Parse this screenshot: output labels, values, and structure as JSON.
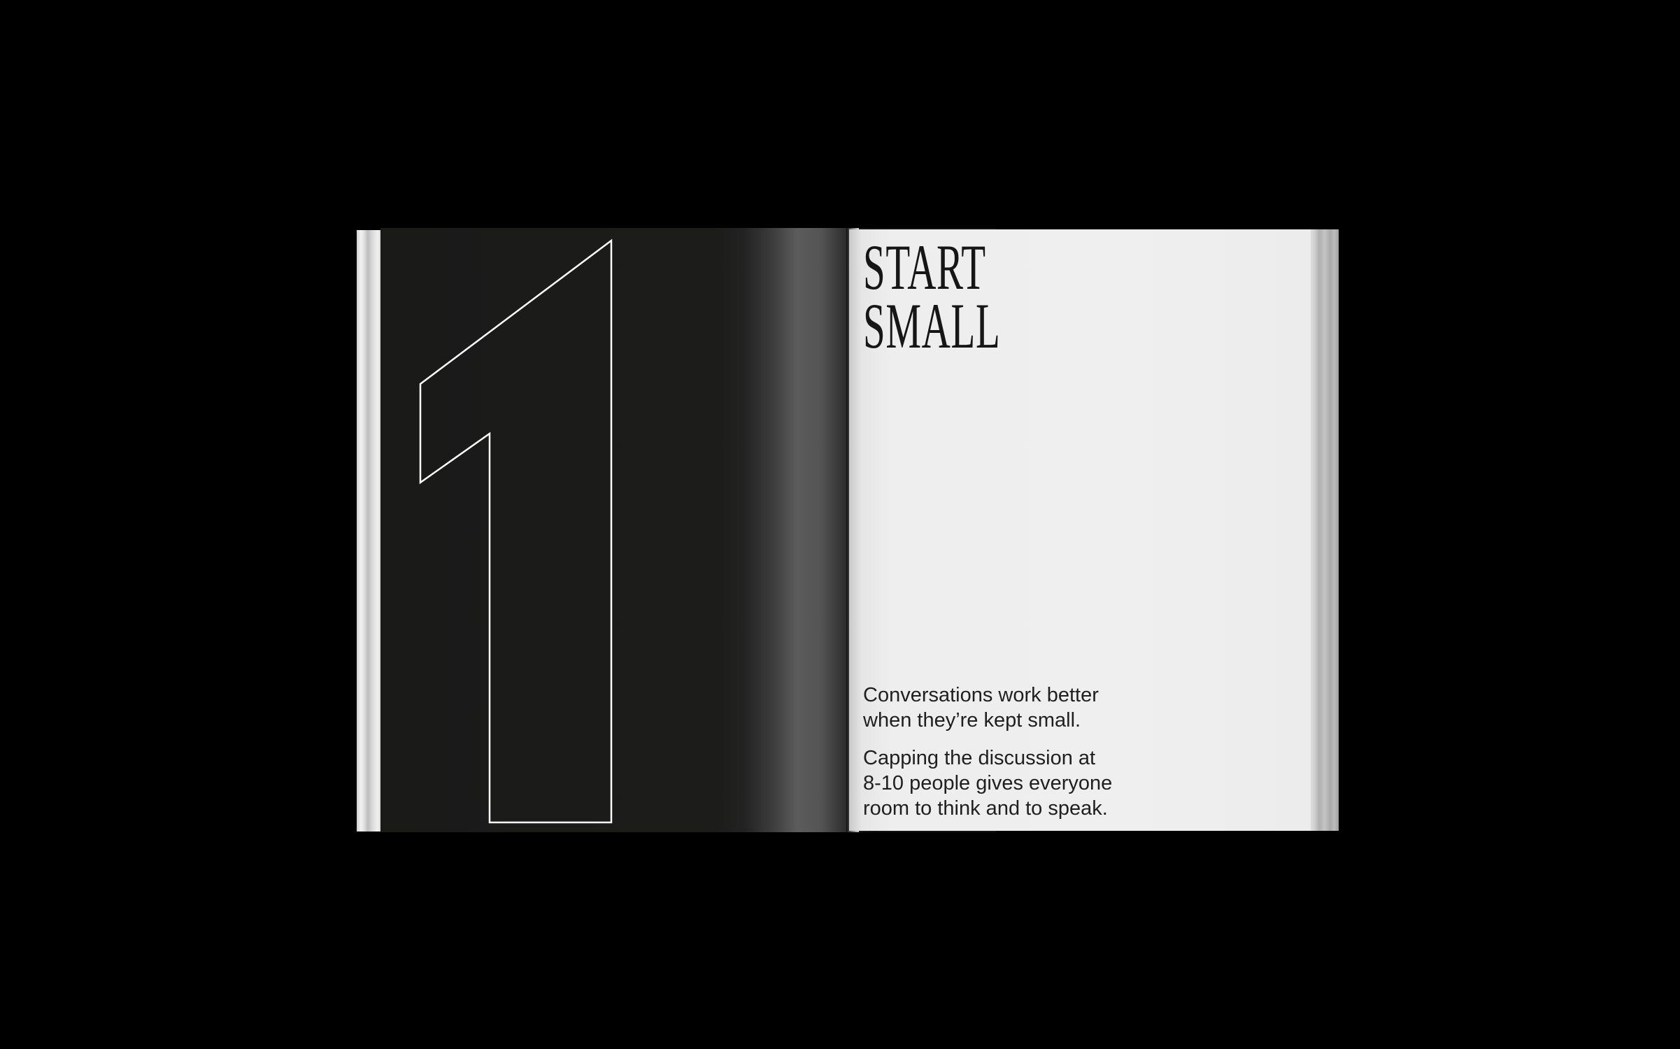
{
  "spread": {
    "left_page": {
      "numeral": "1"
    },
    "right_page": {
      "title_line_1": "START",
      "title_line_2": "SMALL",
      "paragraph_1_line_1": "Conversations work better",
      "paragraph_1_line_2": "when they’re kept small.",
      "paragraph_2_line_1": "Capping the discussion at",
      "paragraph_2_line_2": "8-10 people gives everyone",
      "paragraph_2_line_3": "room to think and to speak."
    }
  },
  "colors": {
    "background": "#000000",
    "left_page": "#1a1a19",
    "right_page": "#efefef",
    "ink": "#161616",
    "outline": "#ffffff"
  }
}
